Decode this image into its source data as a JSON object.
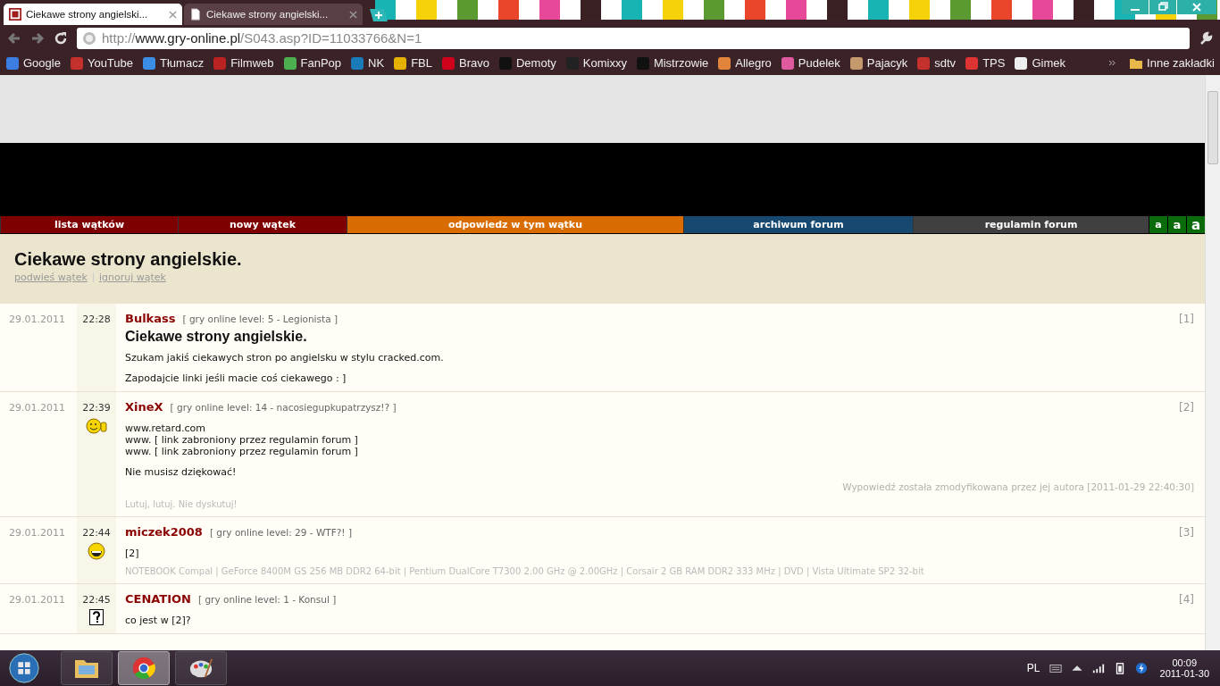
{
  "browser": {
    "tabs": [
      {
        "title": "Ciekawe strony angielski...",
        "selected": true,
        "kind": "site"
      },
      {
        "title": "Ciekawe strony angielski...",
        "selected": false,
        "kind": "page"
      }
    ],
    "address": {
      "scheme": "http://",
      "host": "www.gry-online.pl",
      "path": "/S043.asp?ID=11033766&N=1"
    },
    "bookmarks": [
      {
        "label": "Google"
      },
      {
        "label": "YouTube"
      },
      {
        "label": "Tłumacz"
      },
      {
        "label": "Filmweb"
      },
      {
        "label": "FanPop"
      },
      {
        "label": "NK"
      },
      {
        "label": "FBL"
      },
      {
        "label": "Bravo"
      },
      {
        "label": "Demoty"
      },
      {
        "label": "Komixxy"
      },
      {
        "label": "Mistrzowie"
      },
      {
        "label": "Allegro"
      },
      {
        "label": "Pudelek"
      },
      {
        "label": "Pajacyk"
      },
      {
        "label": "sdtv"
      },
      {
        "label": "TPS"
      },
      {
        "label": "Gimek"
      }
    ],
    "other_bookmarks": "Inne zakładki"
  },
  "nav": [
    {
      "label": "lista wątków",
      "color": "#7f0000"
    },
    {
      "label": "nowy wątek",
      "color": "#7f0000"
    },
    {
      "label": "odpowiedz w tym wątku",
      "color": "#d86c00"
    },
    {
      "label": "archiwum forum",
      "color": "#17486f"
    },
    {
      "label": "regulamin forum",
      "color": "#404040"
    }
  ],
  "font_sizes": [
    "a",
    "a",
    "a"
  ],
  "thread": {
    "title": "Ciekawe strony angielskie.",
    "links": [
      "podwieś wątek",
      "ignoruj wątek"
    ]
  },
  "posts": [
    {
      "date": "29.01.2011",
      "time": "22:28",
      "author": "Bulkass",
      "rank": "[ gry online level: 5 - Legionista ]",
      "number": "[1]",
      "kind": "plain",
      "title": "Ciekawe strony angielskie.",
      "paragraphs": [
        [
          "Szukam jakiś ciekawych stron po angielsku w stylu cracked.com."
        ],
        [
          "Zapodajcie linki jeśli macie coś ciekawego : ]"
        ]
      ]
    },
    {
      "date": "29.01.2011",
      "time": "22:39",
      "author": "XineX",
      "rank": "[ gry online level: 14 - nacosiegupkupatrzysz!? ]",
      "number": "[2]",
      "kind": "thumbs",
      "paragraphs": [
        [
          "www.retard.com",
          "www. [ link zabroniony przez regulamin forum ]",
          "www. [ link zabroniony przez regulamin forum ]"
        ],
        [
          "Nie musisz dziękować!"
        ]
      ],
      "edited": "Wypowiedź została zmodyfikowana przez jej autora [2011-01-29 22:40:30]",
      "signature": "Lutuj, lutuj. Nie dyskutuj!"
    },
    {
      "date": "29.01.2011",
      "time": "22:44",
      "author": "miczek2008",
      "rank": "[ gry online level: 29 - WTF?! ]",
      "number": "[3]",
      "kind": "grin",
      "paragraphs": [
        [
          "[2]"
        ]
      ],
      "signature": "NOTEBOOK Compal | GeForce 8400M GS 256 MB DDR2 64-bit | Pentium DualCore T7300 2.00 GHz @ 2.00GHz | Corsair 2 GB RAM DDR2 333 MHz | DVD | Vista Ultimate SP2 32-bit"
    },
    {
      "date": "29.01.2011",
      "time": "22:45",
      "author": "CENATION",
      "rank": "[ gry online level: 1 - Konsul ]",
      "number": "[4]",
      "kind": "unknown",
      "paragraphs": [
        [
          "co jest w [2]?"
        ]
      ]
    }
  ],
  "taskbar": {
    "apps": [
      {
        "kind": "explorer",
        "selected": false
      },
      {
        "kind": "chrome",
        "selected": true
      },
      {
        "kind": "paint",
        "selected": false
      }
    ],
    "language": "PL",
    "time": "00:09",
    "date": "2011-01-30"
  }
}
